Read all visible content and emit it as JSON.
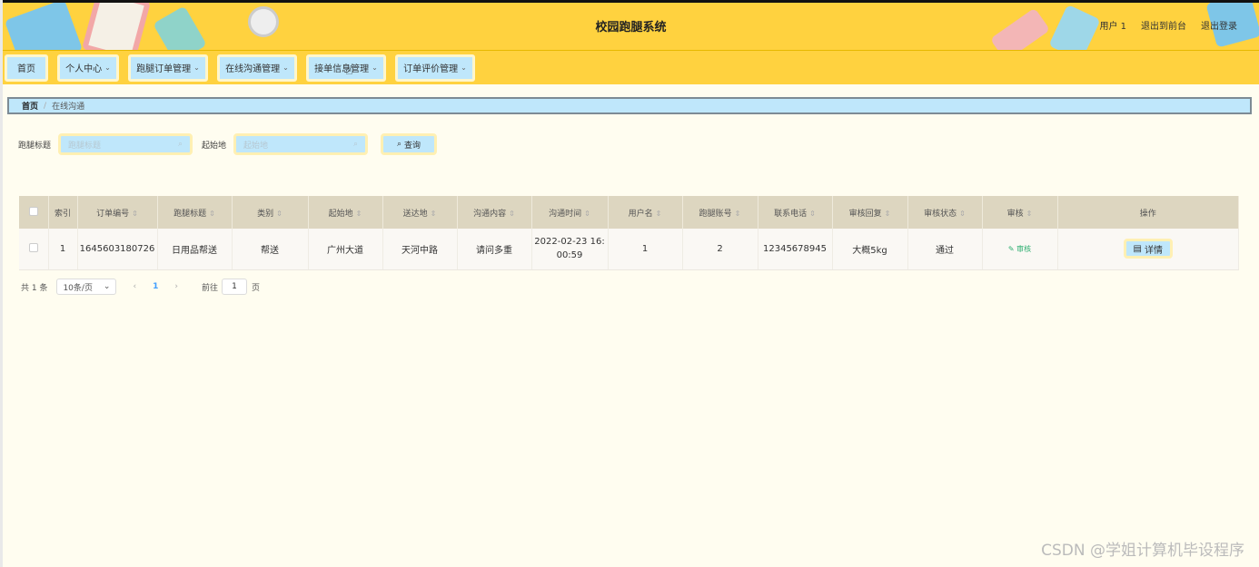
{
  "header": {
    "title": "校园跑腿系统",
    "user": "用户 1",
    "to_front": "退出到前台",
    "logout": "退出登录"
  },
  "nav": [
    {
      "label": "首页",
      "dropdown": false
    },
    {
      "label": "个人中心",
      "dropdown": true
    },
    {
      "label": "跑腿订单管理",
      "dropdown": true
    },
    {
      "label": "在线沟通管理",
      "dropdown": true
    },
    {
      "label": "接单信息管理",
      "dropdown": true
    },
    {
      "label": "订单评价管理",
      "dropdown": true
    }
  ],
  "breadcrumb": {
    "home": "首页",
    "separator": "/",
    "current": "在线沟通"
  },
  "search": {
    "field1_label": "跑腿标题",
    "field1_placeholder": "跑腿标题",
    "field2_label": "起始地",
    "field2_placeholder": "起始地",
    "button": "查询"
  },
  "table": {
    "headers": [
      "索引",
      "订单编号",
      "跑腿标题",
      "类别",
      "起始地",
      "送达地",
      "沟通内容",
      "沟通时间",
      "用户名",
      "跑腿账号",
      "联系电话",
      "审核回复",
      "审核状态",
      "审核",
      "操作"
    ],
    "rows": [
      {
        "index": "1",
        "order_no": "1645603180726",
        "title": "日用品帮送",
        "category": "帮送",
        "from": "广州大道",
        "to": "天河中路",
        "content": "请问多重",
        "time_line1": "2022-02-23 16:",
        "time_line2": "00:59",
        "username": "1",
        "runner_account": "2",
        "phone": "12345678945",
        "reply": "大概5kg",
        "status": "通过",
        "review_link": "审核",
        "action": "详情"
      }
    ]
  },
  "pagination": {
    "total": "共 1 条",
    "page_size": "10条/页",
    "current_page": "1",
    "goto_label": "前往",
    "goto_value": "1",
    "page_unit": "页"
  },
  "watermark": "CSDN @学姐计算机毕设程序",
  "colors": {
    "header_bg": "#ffd23f",
    "button_bg": "#bfe7fb",
    "table_header": "#ddd6c0",
    "success": "#2cae6f"
  }
}
